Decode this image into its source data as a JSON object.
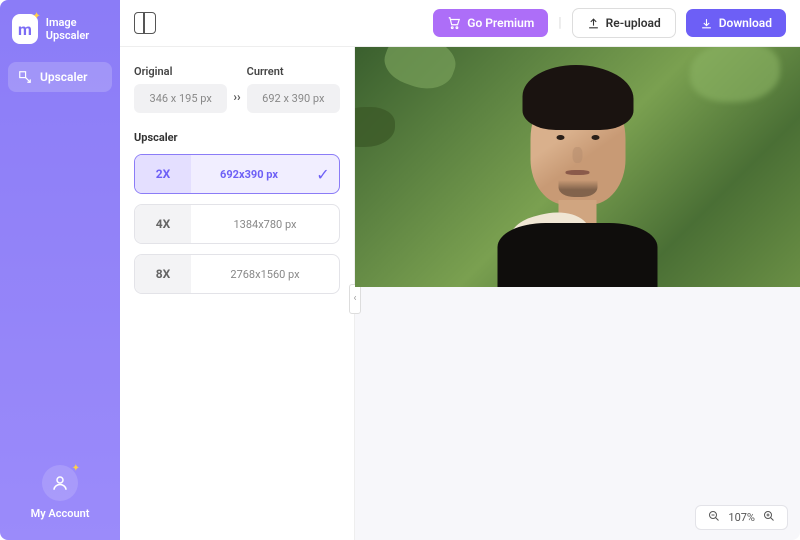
{
  "app": {
    "name": "Image\nUpscaler"
  },
  "sidebar": {
    "nav": [
      {
        "label": "Upscaler"
      }
    ],
    "account_label": "My Account"
  },
  "topbar": {
    "premium": "Go Premium",
    "reupload": "Re-upload",
    "download": "Download"
  },
  "panel": {
    "original_label": "Original",
    "current_label": "Current",
    "original_dim": "346 x 195 px",
    "current_dim": "692 x 390 px",
    "upscaler_label": "Upscaler",
    "options": [
      {
        "mult": "2X",
        "dim": "692x390 px",
        "selected": true
      },
      {
        "mult": "4X",
        "dim": "1384x780 px",
        "selected": false
      },
      {
        "mult": "8X",
        "dim": "2768x1560 px",
        "selected": false
      }
    ]
  },
  "zoom": {
    "value": "107%"
  }
}
